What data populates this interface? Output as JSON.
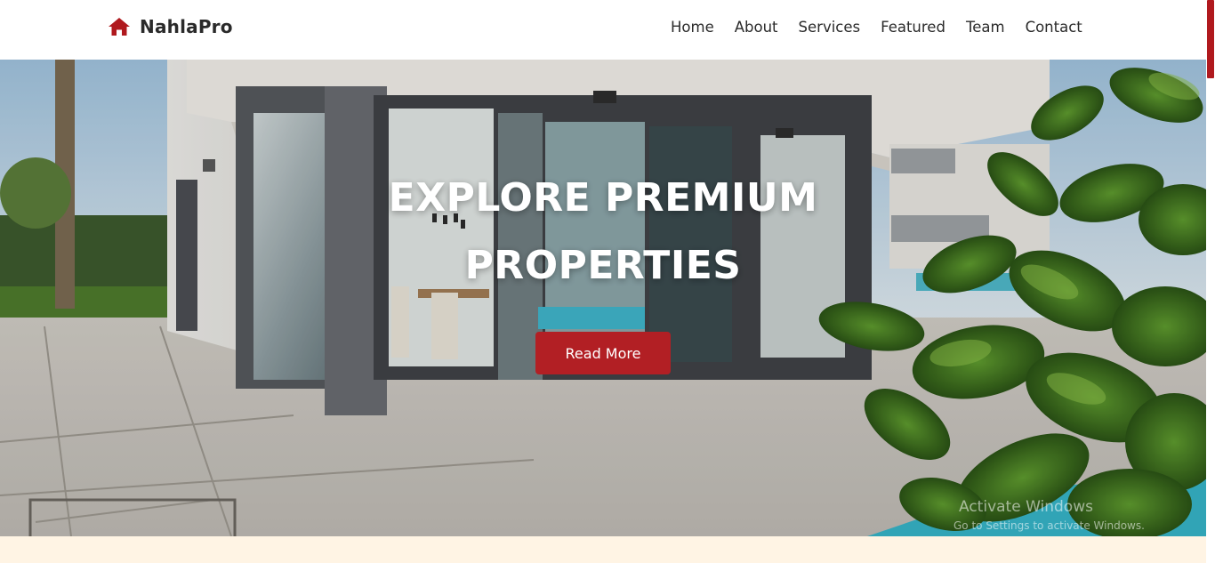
{
  "header": {
    "brand": "NahlaPro",
    "brand_icon": "home-icon",
    "brand_color": "#b0191e",
    "nav": [
      {
        "label": "Home"
      },
      {
        "label": "About"
      },
      {
        "label": "Services"
      },
      {
        "label": "Featured"
      },
      {
        "label": "Team"
      },
      {
        "label": "Contact"
      }
    ]
  },
  "hero": {
    "title_line1": "EXPLORE PREMIUM",
    "title_line2": "PROPERTIES",
    "cta_label": "Read More",
    "cta_color": "#b21f24"
  },
  "watermark": {
    "title": "Activate Windows",
    "subtitle": "Go to Settings to activate Windows."
  },
  "colors": {
    "accent": "#b0191e",
    "section_bg": "#fff4e4"
  }
}
